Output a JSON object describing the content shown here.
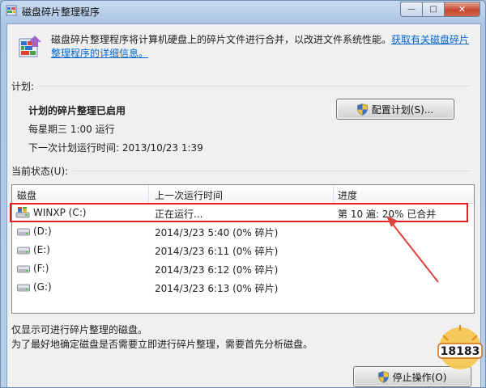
{
  "window": {
    "title": "磁盘碎片整理程序",
    "minimize_glyph": "—",
    "maximize_glyph": "□",
    "close_glyph": "✕"
  },
  "description": {
    "text": "磁盘碎片整理程序将计算机硬盘上的碎片文件进行合并，以改进文件系统性能。",
    "link": "获取有关磁盘碎片整理程序的详细信息。"
  },
  "schedule": {
    "label": "计划:",
    "title": "计划的碎片整理已启用",
    "frequency": "每星期三 1:00 运行",
    "next_run": "下一次计划运行时间: 2013/10/23 1:39",
    "configure_button": "配置计划(S)..."
  },
  "status": {
    "label": "当前状态(U):",
    "columns": [
      "磁盘",
      "上一次运行时间",
      "进度"
    ],
    "rows": [
      {
        "disk": "WINXP (C:)",
        "last_run": "正在运行...",
        "progress": "第 10 遍: 20% 已合并",
        "icon": "system-drive-icon"
      },
      {
        "disk": "(D:)",
        "last_run": "2014/3/23 5:40 (0% 碎片)",
        "progress": "",
        "icon": "drive-icon"
      },
      {
        "disk": "(E:)",
        "last_run": "2014/3/23 6:11 (0% 碎片)",
        "progress": "",
        "icon": "drive-icon"
      },
      {
        "disk": "(F:)",
        "last_run": "2014/3/23 6:12 (0% 碎片)",
        "progress": "",
        "icon": "drive-icon"
      },
      {
        "disk": "(G:)",
        "last_run": "2014/3/23 6:13 (0% 碎片)",
        "progress": "",
        "icon": "drive-icon"
      }
    ]
  },
  "notes": {
    "line1": "仅显示可进行碎片整理的磁盘。",
    "line2": "为了最好地确定磁盘是否需要立即进行碎片整理，需要首先分析磁盘。"
  },
  "actions": {
    "stop_button": "停止操作(O)"
  },
  "watermark": {
    "text": "18183"
  },
  "colors": {
    "highlight": "#e51e25",
    "link": "#0066cc",
    "arrow": "#e0403a"
  }
}
